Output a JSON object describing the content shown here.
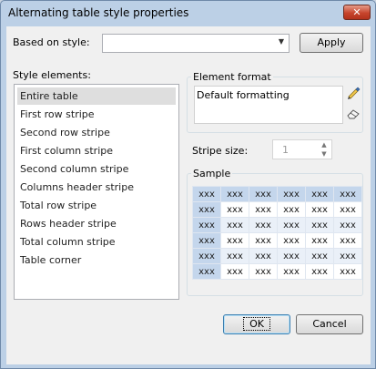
{
  "window": {
    "title": "Alternating table style properties",
    "close_glyph": "✕"
  },
  "based_on": {
    "label": "Based on style:",
    "value": "",
    "apply_label": "Apply"
  },
  "style_elements": {
    "label": "Style elements:",
    "items": [
      "Entire table",
      "First row stripe",
      "Second row stripe",
      "First column stripe",
      "Second column stripe",
      "Columns header stripe",
      "Total row stripe",
      "Rows header stripe",
      "Total column stripe",
      "Table corner"
    ],
    "selected_index": 0
  },
  "element_format": {
    "title": "Element format",
    "value": "Default formatting"
  },
  "stripe_size": {
    "label": "Stripe size:",
    "value": "1"
  },
  "sample": {
    "title": "Sample",
    "cell_text": "xxx",
    "rows": 6,
    "cols": 6
  },
  "footer": {
    "ok_label": "OK",
    "cancel_label": "Cancel"
  },
  "colors": {
    "header_blue": "#c4d6ec",
    "stripe_light": "#eaf0f8",
    "selected_item": "#dedede",
    "close_red": "#c7452d"
  }
}
